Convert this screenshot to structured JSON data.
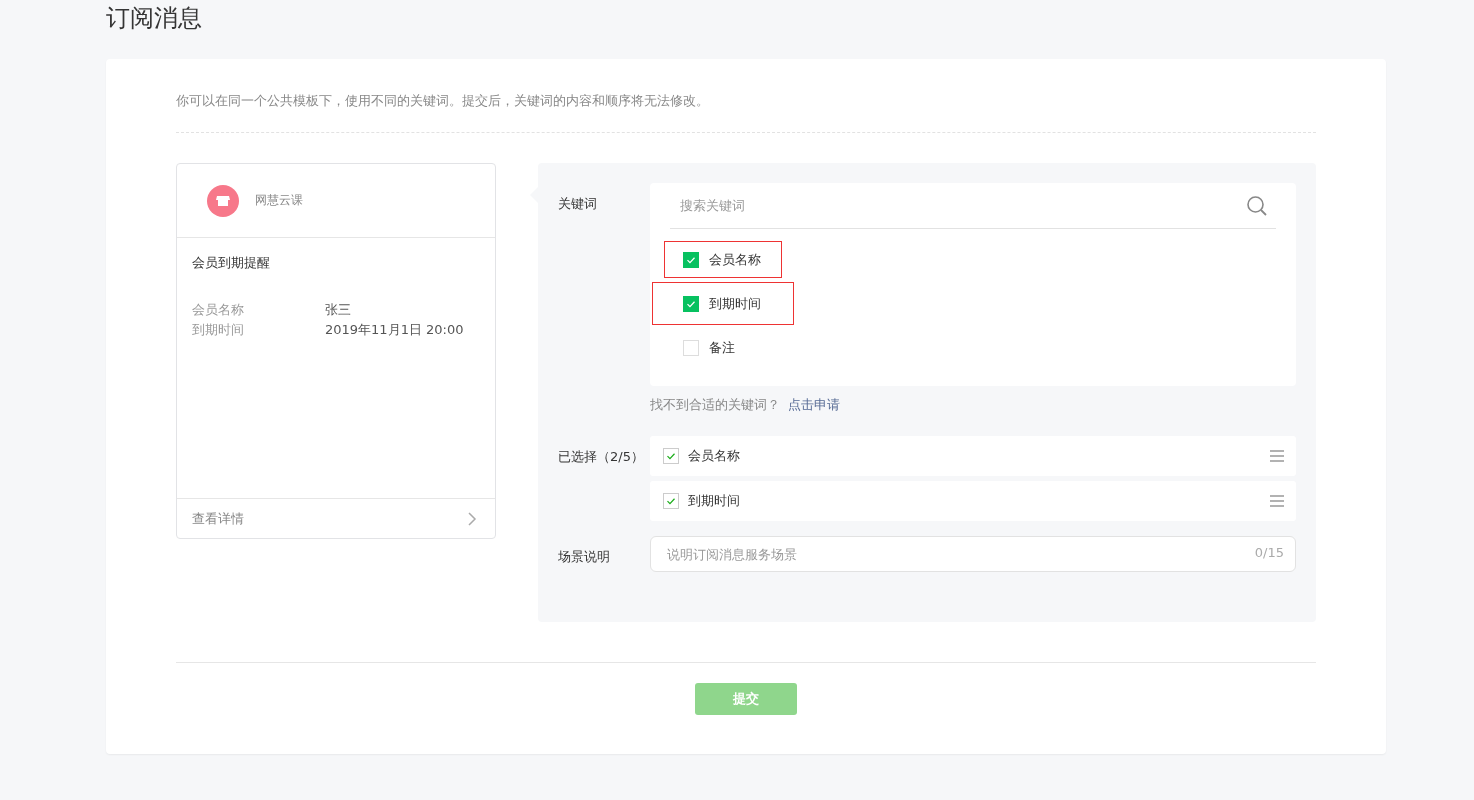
{
  "page_title": "订阅消息",
  "intro": "你可以在同一个公共模板下，使用不同的关键词。提交后，关键词的内容和顺序将无法修改。",
  "preview": {
    "account": "网慧云课",
    "template_title": "会员到期提醒",
    "fields": [
      {
        "label": "会员名称",
        "value": "张三"
      },
      {
        "label": "到期时间",
        "value": "2019年11月1日 20:00"
      }
    ],
    "footer_link": "查看详情"
  },
  "keywords": {
    "label": "关键词",
    "search": {
      "placeholder": "搜索关键词"
    },
    "options": [
      {
        "label": "会员名称",
        "checked": true,
        "highlighted": true
      },
      {
        "label": "到期时间",
        "checked": true,
        "highlighted": true
      },
      {
        "label": "备注",
        "checked": false,
        "highlighted": false
      }
    ],
    "hint": "找不到合适的关键词？",
    "apply_link": "点击申请"
  },
  "selected": {
    "label": "已选择（2/5）",
    "items": [
      {
        "label": "会员名称",
        "checked": true
      },
      {
        "label": "到期时间",
        "checked": true
      }
    ]
  },
  "scene": {
    "label": "场景说明",
    "placeholder": "说明订阅消息服务场景",
    "counter": "0/15"
  },
  "submit": {
    "label": "提交",
    "disabled": true
  }
}
